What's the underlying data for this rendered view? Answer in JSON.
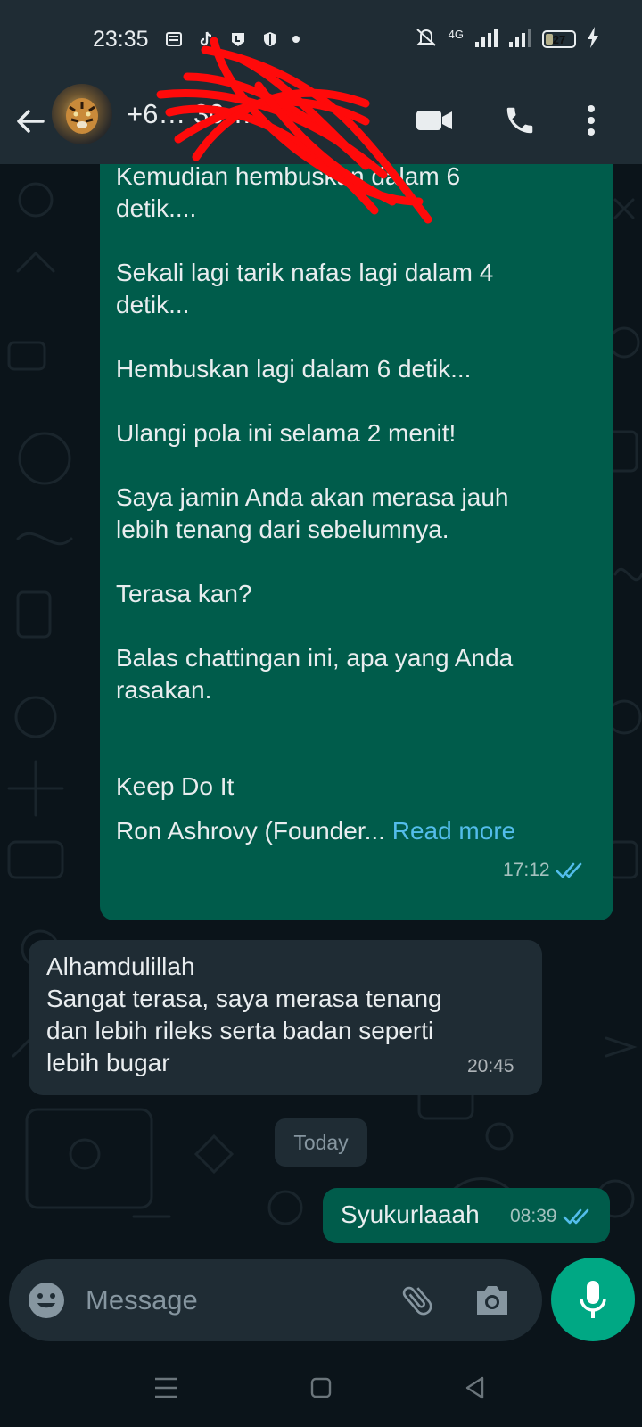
{
  "status_bar": {
    "time": "23:35",
    "network": "4G",
    "battery": "27",
    "battery_fraction": 0.27
  },
  "header": {
    "contact_name": "+6… 30…",
    "avatar_icon": "tiger-avatar",
    "icons": [
      "back-arrow-icon",
      "video-call-icon",
      "phone-icon",
      "more-vert-icon"
    ]
  },
  "messages": [
    {
      "direction": "out",
      "lines": [
        "Kemudian hembuskan dalam 6",
        "detik....",
        "",
        "Sekali lagi tarik nafas lagi dalam 4",
        "detik...",
        "",
        "Hembuskan lagi dalam 6 detik...",
        "",
        "Ulangi pola ini selama 2 menit!",
        "",
        "Saya jamin Anda akan merasa jauh",
        "lebih tenang dari sebelumnya.",
        "",
        "Terasa kan?",
        "",
        "Balas chattingan ini, apa yang Anda",
        "rasakan.",
        "",
        "",
        "Keep Do It"
      ],
      "last_line": "Ron Ashrovy (Founder...",
      "read_more": "Read more",
      "time": "17:12",
      "status": "read"
    },
    {
      "direction": "in",
      "lines": [
        "Alhamdulillah",
        "Sangat terasa, saya merasa tenang",
        "dan lebih rileks serta badan seperti",
        "lebih bugar"
      ],
      "time": "20:45"
    },
    {
      "direction": "out",
      "text": "Syukurlaaah",
      "time": "08:39",
      "status": "read"
    }
  ],
  "date_separator": "Today",
  "composer": {
    "placeholder": "Message",
    "icons": [
      "emoji-icon",
      "attach-icon",
      "camera-icon",
      "mic-icon"
    ]
  },
  "colors": {
    "outgoing_bubble": "#005c4b",
    "incoming_bubble": "#1f2c34",
    "accent": "#00a884",
    "read_ticks": "#53bdeb",
    "background": "#0b141a"
  }
}
